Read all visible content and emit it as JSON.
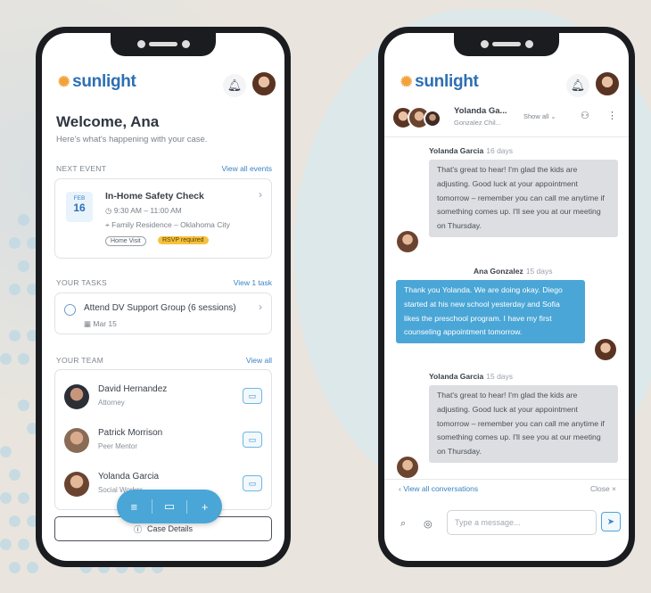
{
  "brand": {
    "logo_text": "sunlight",
    "accent": "#4aa6d6",
    "primary": "#2d6fb3"
  },
  "left": {
    "welcome_title": "Welcome, Ana",
    "welcome_subtitle": "Here's what's happening with your case.",
    "next_event": {
      "label": "NEXT EVENT",
      "link": "View all events",
      "month": "FEB",
      "day": "16",
      "title": "In-Home Safety Check",
      "time": "9:30 AM – 11:00 AM",
      "location": "Family Residence – Oklahoma City",
      "tag_visit": "Home Visit",
      "tag_rsvp": "RSVP required",
      "icon_time": "clock-icon",
      "icon_location": "pin-icon"
    },
    "tasks": {
      "label": "YOUR TASKS",
      "link": "View 1 task",
      "items": [
        {
          "title": "Attend DV Support Group (6 sessions)",
          "due": "Mar 15"
        }
      ]
    },
    "team": {
      "label": "YOUR TEAM",
      "link": "View all",
      "members": [
        {
          "name": "David Hernandez",
          "role": "Attorney"
        },
        {
          "name": "Patrick Morrison",
          "role": "Peer Mentor"
        },
        {
          "name": "Yolanda Garcia",
          "role": "Social Worker"
        }
      ]
    },
    "fab": {
      "menu_icon": "≡",
      "chat_icon": "💬",
      "add_icon": "+"
    },
    "case_details": "Case Details"
  },
  "right": {
    "header": {
      "name": "Yolanda Ga...",
      "sub": "Gonzalez Chil...",
      "show_all": "Show all ⌄"
    },
    "messages": [
      {
        "sender": "Yolanda Garcia",
        "time": "16 days",
        "direction": "in",
        "text": "That's great to hear! I'm glad the kids are adjusting. Good luck at your appointment tomorrow – remember you can call me anytime if something comes up. I'll see you at our meeting on Thursday."
      },
      {
        "sender": "Ana Gonzalez",
        "time": "15 days",
        "direction": "out",
        "text": "Thank you Yolanda. We are doing okay. Diego started at his new school yesterday and Sofia likes the preschool program. I have my first counseling appointment tomorrow."
      },
      {
        "sender": "Yolanda Garcia",
        "time": "15 days",
        "direction": "in",
        "text": "That's great to hear! I'm glad the kids are adjusting. Good luck at your appointment tomorrow – remember you can call me anytime if something comes up. I'll see you at our meeting on Thursday."
      }
    ],
    "view_all_conversations": "‹  View all conversations",
    "close": "Close ×",
    "input_placeholder": "Type a message..."
  }
}
